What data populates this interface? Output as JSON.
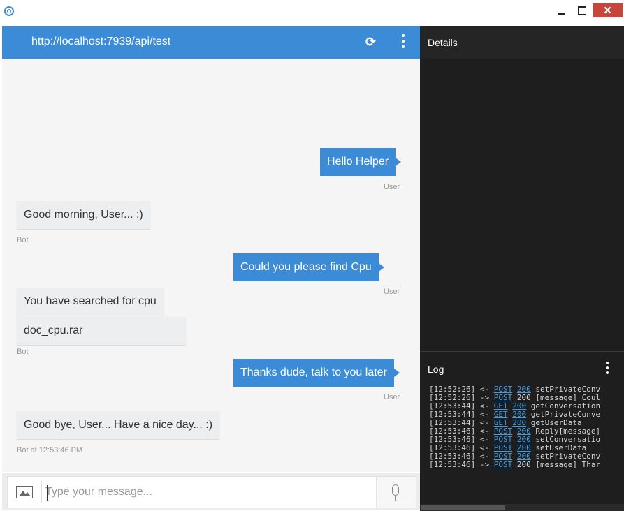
{
  "window": {
    "minimize": "—",
    "maximize": "□",
    "close": "✕"
  },
  "chat": {
    "url": "http://localhost:7939/api/test",
    "messages": [
      {
        "from": "user",
        "text": "Hello  Helper",
        "meta": "User"
      },
      {
        "from": "bot",
        "text": "Good morning, User... :)",
        "meta": "Bot"
      },
      {
        "from": "user",
        "text": "Could you please find Cpu",
        "meta": "User"
      },
      {
        "from": "bot",
        "text": "You have searched for cpu"
      },
      {
        "from": "bot",
        "text": "doc_cpu.rar",
        "meta": "Bot"
      },
      {
        "from": "user",
        "text": "Thanks dude, talk to you later",
        "meta": "User"
      },
      {
        "from": "bot",
        "text": "Good bye, User... Have a nice day... :)",
        "meta": "Bot at 12:53:46 PM"
      }
    ],
    "input_placeholder": "Type your message..."
  },
  "details": {
    "title": "Details"
  },
  "log": {
    "title": "Log",
    "lines": [
      {
        "time": "[12:52:26]",
        "dir": "<-",
        "method": "POST",
        "status": "200",
        "status_linked": true,
        "text": "setPrivateConv"
      },
      {
        "time": "[12:52:26]",
        "dir": "->",
        "method": "POST",
        "status": "200",
        "status_linked": false,
        "text": "[message] Coul"
      },
      {
        "time": "[12:53:44]",
        "dir": "<-",
        "method": "GET",
        "status": "200",
        "status_linked": true,
        "text": "getConversation"
      },
      {
        "time": "[12:53:44]",
        "dir": "<-",
        "method": "GET",
        "status": "200",
        "status_linked": true,
        "text": "getPrivateConve"
      },
      {
        "time": "[12:53:44]",
        "dir": "<-",
        "method": "GET",
        "status": "200",
        "status_linked": true,
        "text": "getUserData"
      },
      {
        "time": "[12:53:46]",
        "dir": "<-",
        "method": "POST",
        "status": "200",
        "status_linked": true,
        "text": "Reply[message]"
      },
      {
        "time": "[12:53:46]",
        "dir": "<-",
        "method": "POST",
        "status": "200",
        "status_linked": true,
        "text": "setConversatio"
      },
      {
        "time": "[12:53:46]",
        "dir": "<-",
        "method": "POST",
        "status": "200",
        "status_linked": true,
        "text": "setUserData"
      },
      {
        "time": "[12:53:46]",
        "dir": "<-",
        "method": "POST",
        "status": "200",
        "status_linked": true,
        "text": "setPrivateConv"
      },
      {
        "time": "[12:53:46]",
        "dir": "->",
        "method": "POST",
        "status": "200",
        "status_linked": false,
        "text": "[message] Thar"
      }
    ]
  },
  "colors": {
    "accent": "#3c8bd6",
    "chat_bg": "#f5f5f5",
    "panel_bg": "#1e1e1e",
    "close_red": "#c7463c",
    "link_blue": "#3c9dea"
  },
  "icons": {
    "app": "emulator-logo-icon",
    "refresh": "refresh-icon",
    "menu": "kebab-menu-icon",
    "image": "image-upload-icon",
    "mic": "microphone-icon"
  }
}
